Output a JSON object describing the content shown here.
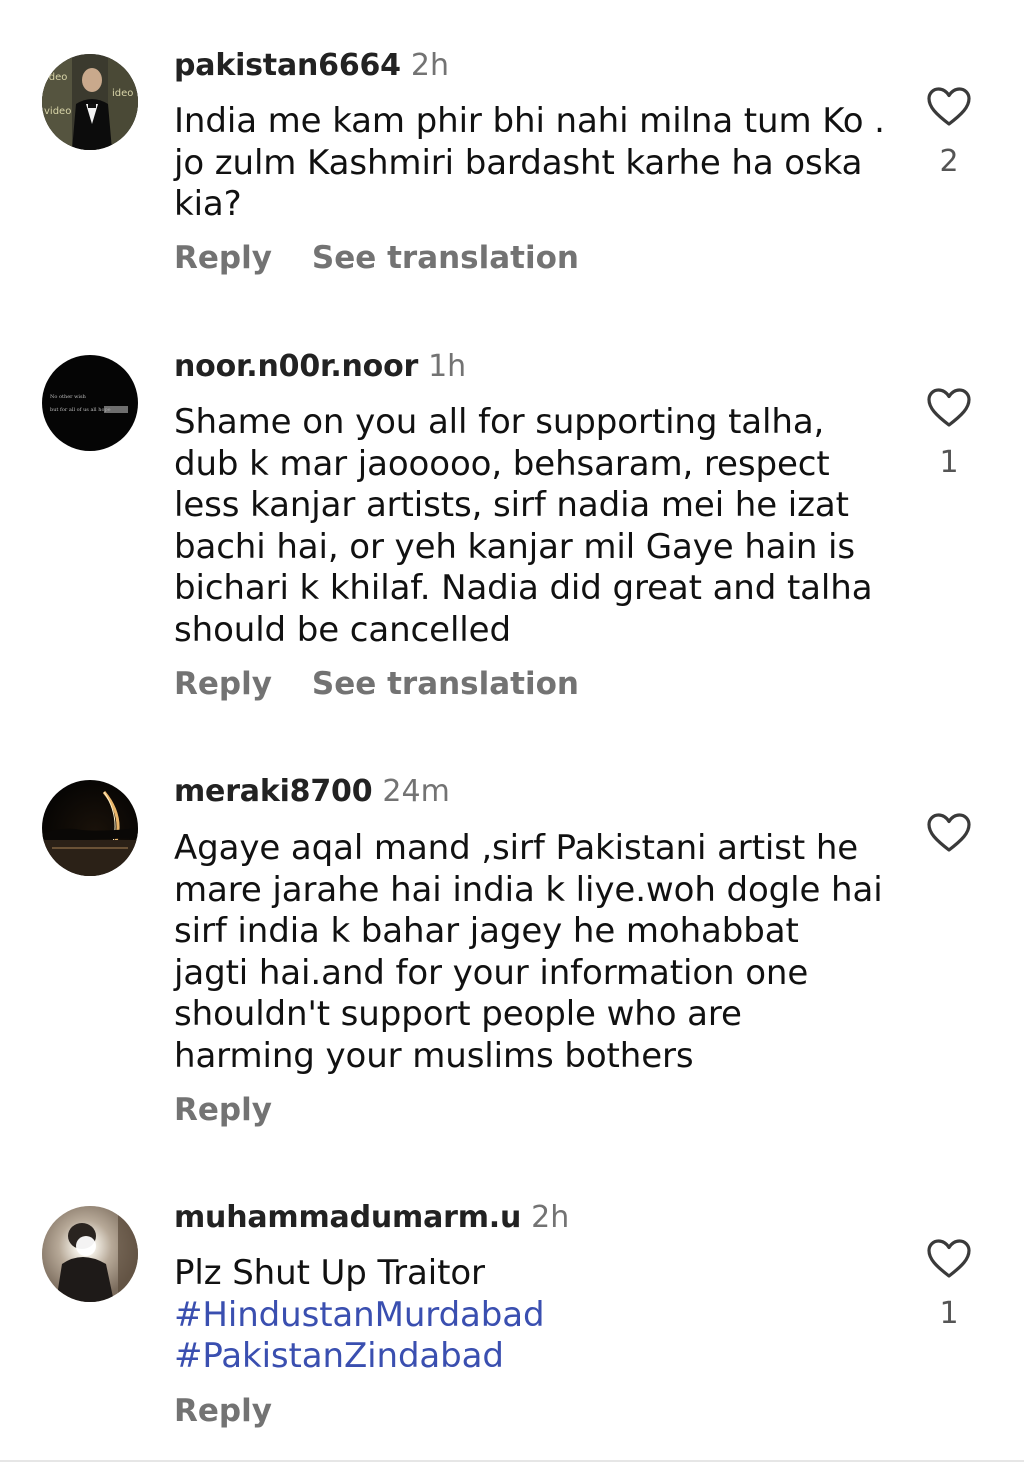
{
  "comments": [
    {
      "username": "pakistan6664",
      "time": "2h",
      "lines": [
        "India me kam phir bhi nahi milna tum Ko .",
        "jo zulm Kashmiri bardasht karhe ha oska",
        "kia?"
      ],
      "reply": "Reply",
      "translate": "See translation",
      "likes": "2"
    },
    {
      "username": "noor.n00r.noor",
      "time": "1h",
      "lines": [
        "Shame on you all for supporting talha,",
        "dub k mar jaooooo, behsaram, respect",
        "less kanjar artists, sirf nadia mei he izat",
        "bachi hai, or yeh kanjar mil Gaye hain is",
        "bichari k khilaf. Nadia did great and talha",
        "should be cancelled"
      ],
      "reply": "Reply",
      "translate": "See translation",
      "likes": "1"
    },
    {
      "username": "meraki8700",
      "time": "24m",
      "lines": [
        "Agaye aqal mand ,sirf Pakistani artist he",
        "mare jarahe hai india k liye.woh dogle hai",
        "sirf india k bahar jagey he mohabbat",
        "jagti hai.and for your information one",
        "shouldn't support people who are",
        "harming your muslims bothers"
      ],
      "reply": "Reply"
    },
    {
      "username": "muhammadumarm.u",
      "time": "2h",
      "lines": [
        "Plz Shut Up Traitor"
      ],
      "hashtags": [
        "#HindustanMurdabad",
        "#PakistanZindabad"
      ],
      "reply": "Reply",
      "likes": "1"
    }
  ],
  "avatar_texts": {
    "c1_left": "ideo",
    "c1_right": "ideo",
    "c1_bottom": "video",
    "c2_line1": "No other wish",
    "c2_line2": "but for all of us all hope"
  },
  "icons": {
    "like": "heart-outline-icon"
  },
  "colors": {
    "text": "#111111",
    "secondary": "#737373",
    "hashtag": "#3a4fb0"
  }
}
